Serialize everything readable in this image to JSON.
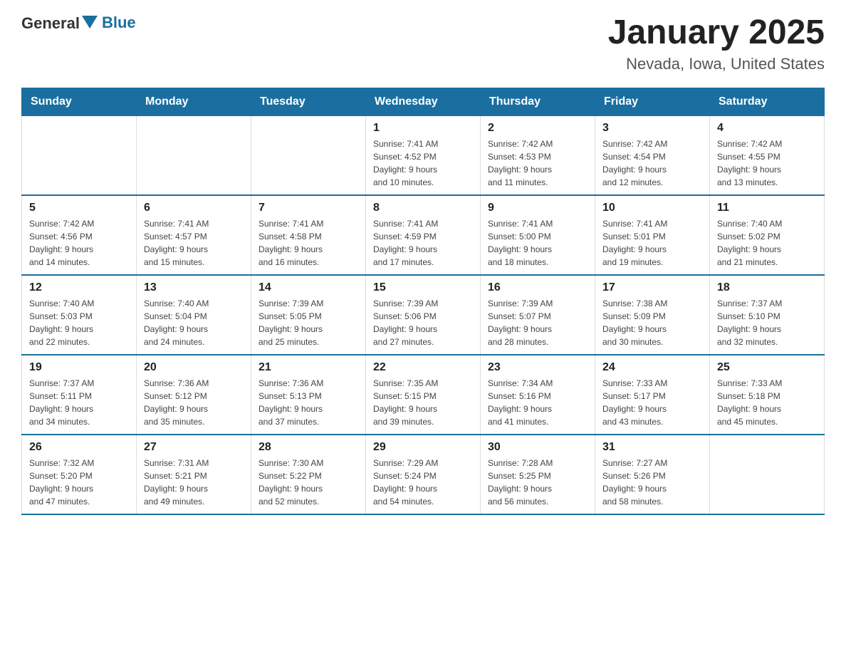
{
  "logo": {
    "general": "General",
    "blue": "Blue"
  },
  "title": "January 2025",
  "subtitle": "Nevada, Iowa, United States",
  "days": [
    "Sunday",
    "Monday",
    "Tuesday",
    "Wednesday",
    "Thursday",
    "Friday",
    "Saturday"
  ],
  "weeks": [
    [
      {
        "day": "",
        "info": ""
      },
      {
        "day": "",
        "info": ""
      },
      {
        "day": "",
        "info": ""
      },
      {
        "day": "1",
        "info": "Sunrise: 7:41 AM\nSunset: 4:52 PM\nDaylight: 9 hours\nand 10 minutes."
      },
      {
        "day": "2",
        "info": "Sunrise: 7:42 AM\nSunset: 4:53 PM\nDaylight: 9 hours\nand 11 minutes."
      },
      {
        "day": "3",
        "info": "Sunrise: 7:42 AM\nSunset: 4:54 PM\nDaylight: 9 hours\nand 12 minutes."
      },
      {
        "day": "4",
        "info": "Sunrise: 7:42 AM\nSunset: 4:55 PM\nDaylight: 9 hours\nand 13 minutes."
      }
    ],
    [
      {
        "day": "5",
        "info": "Sunrise: 7:42 AM\nSunset: 4:56 PM\nDaylight: 9 hours\nand 14 minutes."
      },
      {
        "day": "6",
        "info": "Sunrise: 7:41 AM\nSunset: 4:57 PM\nDaylight: 9 hours\nand 15 minutes."
      },
      {
        "day": "7",
        "info": "Sunrise: 7:41 AM\nSunset: 4:58 PM\nDaylight: 9 hours\nand 16 minutes."
      },
      {
        "day": "8",
        "info": "Sunrise: 7:41 AM\nSunset: 4:59 PM\nDaylight: 9 hours\nand 17 minutes."
      },
      {
        "day": "9",
        "info": "Sunrise: 7:41 AM\nSunset: 5:00 PM\nDaylight: 9 hours\nand 18 minutes."
      },
      {
        "day": "10",
        "info": "Sunrise: 7:41 AM\nSunset: 5:01 PM\nDaylight: 9 hours\nand 19 minutes."
      },
      {
        "day": "11",
        "info": "Sunrise: 7:40 AM\nSunset: 5:02 PM\nDaylight: 9 hours\nand 21 minutes."
      }
    ],
    [
      {
        "day": "12",
        "info": "Sunrise: 7:40 AM\nSunset: 5:03 PM\nDaylight: 9 hours\nand 22 minutes."
      },
      {
        "day": "13",
        "info": "Sunrise: 7:40 AM\nSunset: 5:04 PM\nDaylight: 9 hours\nand 24 minutes."
      },
      {
        "day": "14",
        "info": "Sunrise: 7:39 AM\nSunset: 5:05 PM\nDaylight: 9 hours\nand 25 minutes."
      },
      {
        "day": "15",
        "info": "Sunrise: 7:39 AM\nSunset: 5:06 PM\nDaylight: 9 hours\nand 27 minutes."
      },
      {
        "day": "16",
        "info": "Sunrise: 7:39 AM\nSunset: 5:07 PM\nDaylight: 9 hours\nand 28 minutes."
      },
      {
        "day": "17",
        "info": "Sunrise: 7:38 AM\nSunset: 5:09 PM\nDaylight: 9 hours\nand 30 minutes."
      },
      {
        "day": "18",
        "info": "Sunrise: 7:37 AM\nSunset: 5:10 PM\nDaylight: 9 hours\nand 32 minutes."
      }
    ],
    [
      {
        "day": "19",
        "info": "Sunrise: 7:37 AM\nSunset: 5:11 PM\nDaylight: 9 hours\nand 34 minutes."
      },
      {
        "day": "20",
        "info": "Sunrise: 7:36 AM\nSunset: 5:12 PM\nDaylight: 9 hours\nand 35 minutes."
      },
      {
        "day": "21",
        "info": "Sunrise: 7:36 AM\nSunset: 5:13 PM\nDaylight: 9 hours\nand 37 minutes."
      },
      {
        "day": "22",
        "info": "Sunrise: 7:35 AM\nSunset: 5:15 PM\nDaylight: 9 hours\nand 39 minutes."
      },
      {
        "day": "23",
        "info": "Sunrise: 7:34 AM\nSunset: 5:16 PM\nDaylight: 9 hours\nand 41 minutes."
      },
      {
        "day": "24",
        "info": "Sunrise: 7:33 AM\nSunset: 5:17 PM\nDaylight: 9 hours\nand 43 minutes."
      },
      {
        "day": "25",
        "info": "Sunrise: 7:33 AM\nSunset: 5:18 PM\nDaylight: 9 hours\nand 45 minutes."
      }
    ],
    [
      {
        "day": "26",
        "info": "Sunrise: 7:32 AM\nSunset: 5:20 PM\nDaylight: 9 hours\nand 47 minutes."
      },
      {
        "day": "27",
        "info": "Sunrise: 7:31 AM\nSunset: 5:21 PM\nDaylight: 9 hours\nand 49 minutes."
      },
      {
        "day": "28",
        "info": "Sunrise: 7:30 AM\nSunset: 5:22 PM\nDaylight: 9 hours\nand 52 minutes."
      },
      {
        "day": "29",
        "info": "Sunrise: 7:29 AM\nSunset: 5:24 PM\nDaylight: 9 hours\nand 54 minutes."
      },
      {
        "day": "30",
        "info": "Sunrise: 7:28 AM\nSunset: 5:25 PM\nDaylight: 9 hours\nand 56 minutes."
      },
      {
        "day": "31",
        "info": "Sunrise: 7:27 AM\nSunset: 5:26 PM\nDaylight: 9 hours\nand 58 minutes."
      },
      {
        "day": "",
        "info": ""
      }
    ]
  ]
}
